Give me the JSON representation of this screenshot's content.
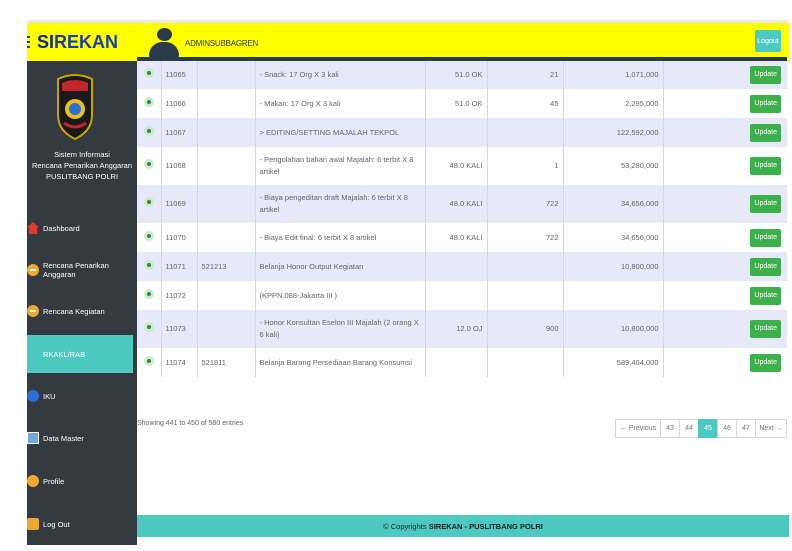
{
  "header": {
    "brand_si": "SI",
    "brand_rest": "REKAN",
    "username": "ADMINSUBBAGREN",
    "logout": "Logout"
  },
  "sidebar": {
    "title_lines": [
      "Sistem Informasi",
      "Rencana Penarikan Anggaran",
      "PUSLITBANG POLRI"
    ],
    "items": [
      {
        "label": "Dashboard",
        "icon": "home-icon"
      },
      {
        "label": "Rencana Penarikan Anggaran",
        "icon": "minus-circle-icon"
      },
      {
        "label": "Rencana Kegiatan",
        "icon": "minus-circle-icon"
      },
      {
        "label": "RKAKL/RAB",
        "icon": "list-icon",
        "active": true
      },
      {
        "label": "IKU",
        "icon": "circle-icon"
      },
      {
        "label": "Data Master",
        "icon": "database-icon"
      },
      {
        "label": "Profile",
        "icon": "user-icon"
      },
      {
        "label": "Log Out",
        "icon": "logout-icon"
      }
    ]
  },
  "table": {
    "rows": [
      {
        "id": "11065",
        "kode": "",
        "uraian": "- Snack: 17 Org X 3 kali",
        "vol": "51.0 OK",
        "qty": "21",
        "total": "1,071,000",
        "action": "Update"
      },
      {
        "id": "11066",
        "kode": "",
        "uraian": "- Makan: 17 Org X 3 kali",
        "vol": "51.0 OK",
        "qty": "45",
        "total": "2,295,000",
        "action": "Update"
      },
      {
        "id": "11067",
        "kode": "",
        "uraian": "> EDITING/SETTING MAJALAH TEKPOL",
        "vol": "",
        "qty": "",
        "total": "122,592,000",
        "action": "Update"
      },
      {
        "id": "11068",
        "kode": "",
        "uraian": "- Pengolahan bahan awal Majalah: 6 terbit X 8 artikel",
        "vol": "48.0 KALI",
        "qty": "1",
        "total": "53,280,000",
        "action": "Update"
      },
      {
        "id": "11069",
        "kode": "",
        "uraian": "- Biaya pengeditan draft Majalah: 6 terbit X 8 artikel",
        "vol": "48.0 KALI",
        "qty": "722",
        "total": "34,656,000",
        "action": "Update"
      },
      {
        "id": "11070",
        "kode": "",
        "uraian": "- Biaya Edit final: 6 terbit X 8 artikel",
        "vol": "48.0 KALI",
        "qty": "722",
        "total": "34,656,000",
        "action": "Update"
      },
      {
        "id": "11071",
        "kode": "521213",
        "uraian": "Belanja Honor Output Kegiatan",
        "vol": "",
        "qty": "",
        "total": "10,800,000",
        "action": "Update"
      },
      {
        "id": "11072",
        "kode": "",
        "uraian": "(KPPN.088-Jakarta III )",
        "vol": "",
        "qty": "",
        "total": "",
        "action": "Update"
      },
      {
        "id": "11073",
        "kode": "",
        "uraian": "- Honor Konsultan Eselon III Majalah (2 orang X 6 kali)",
        "vol": "12.0 OJ",
        "qty": "900",
        "total": "10,800,000",
        "action": "Update"
      },
      {
        "id": "11074",
        "kode": "521811",
        "uraian": "Belanja Barang Persediaan Barang Konsumsi",
        "vol": "",
        "qty": "",
        "total": "589,404,000",
        "action": "Update"
      }
    ],
    "showing": "Showing 441 to 450 of 580 entries"
  },
  "pagination": {
    "prev": "← Previous",
    "pages": [
      "43",
      "44",
      "45",
      "46",
      "47"
    ],
    "active": "45",
    "next": "Next →"
  },
  "footer": {
    "prefix": "© Copyrights ",
    "bold": "SIREKAN - PUSLITBANG POLRI"
  },
  "colors": {
    "topbar": "#ffff00",
    "sidebar": "#333a40",
    "accent": "#4ec9c2",
    "update_button": "#3cb04a",
    "row_alt": "#e7e8f8"
  }
}
